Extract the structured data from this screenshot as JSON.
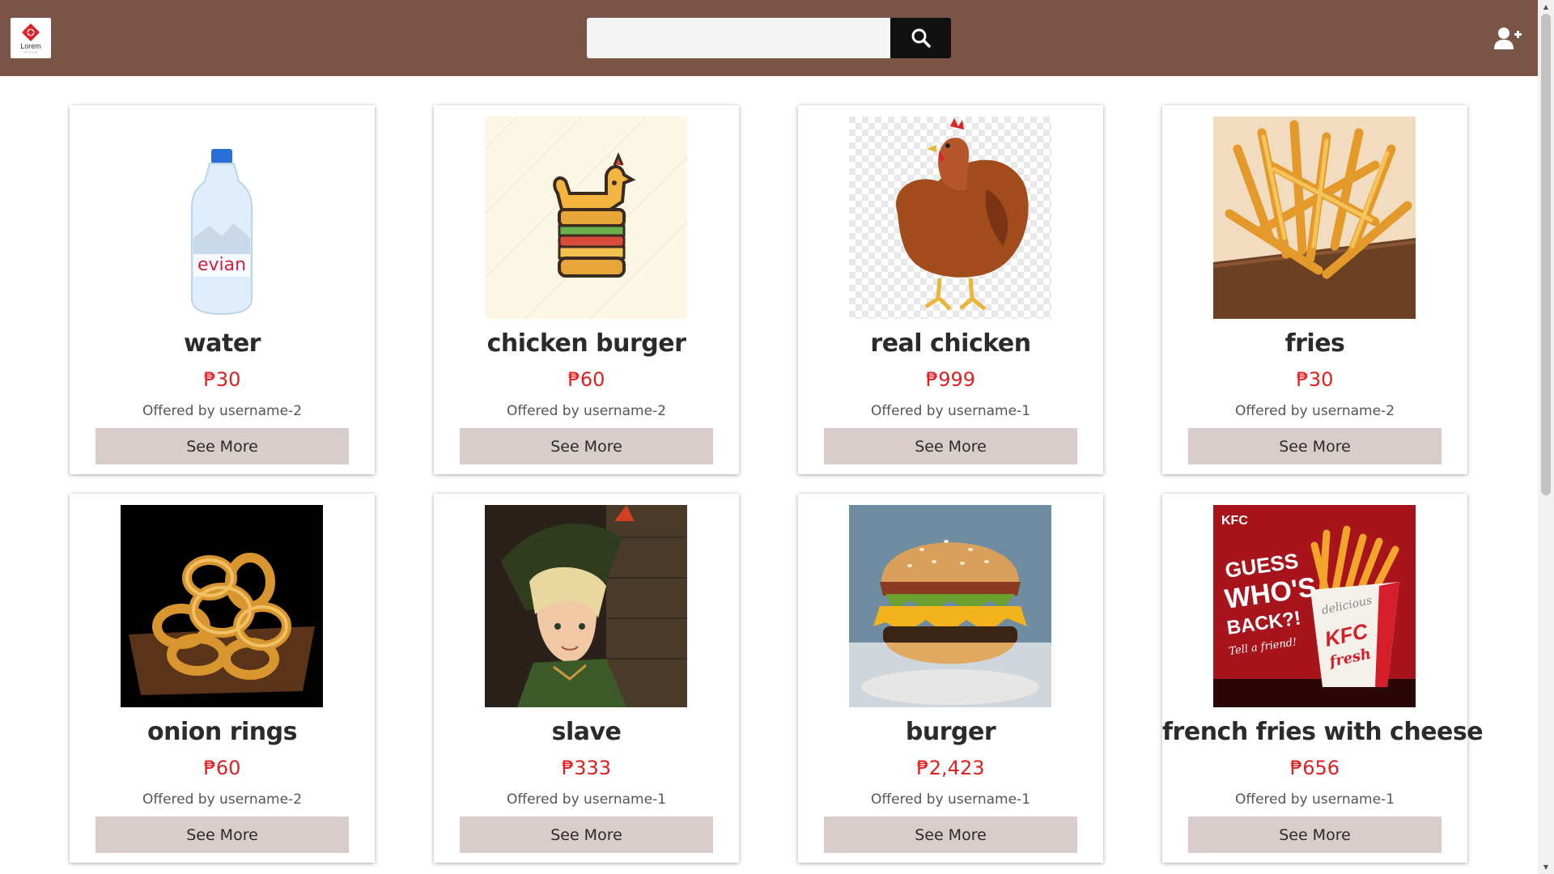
{
  "header": {
    "logo_text": "Lorem",
    "logo_sub": "IPSUM",
    "search_placeholder": "",
    "search_value": ""
  },
  "colors": {
    "header_bg": "#7a5446",
    "price": "#e02020",
    "button_bg": "#d8cdca"
  },
  "products": [
    {
      "name": "water",
      "price": "₱30",
      "offered_by": "Offered by username-2",
      "button": "See More",
      "image": "water-bottle"
    },
    {
      "name": "chicken burger",
      "price": "₱60",
      "offered_by": "Offered by username-2",
      "button": "See More",
      "image": "chicken-burger-logo"
    },
    {
      "name": "real chicken",
      "price": "₱999",
      "offered_by": "Offered by username-1",
      "button": "See More",
      "image": "hen"
    },
    {
      "name": "fries",
      "price": "₱30",
      "offered_by": "Offered by username-2",
      "button": "See More",
      "image": "fries"
    },
    {
      "name": "onion rings",
      "price": "₱60",
      "offered_by": "Offered by username-2",
      "button": "See More",
      "image": "onion-rings"
    },
    {
      "name": "slave",
      "price": "₱333",
      "offered_by": "Offered by username-1",
      "button": "See More",
      "image": "game-character"
    },
    {
      "name": "burger",
      "price": "₱2,423",
      "offered_by": "Offered by username-1",
      "button": "See More",
      "image": "burger"
    },
    {
      "name": "french fries with cheese",
      "price": "₱656",
      "offered_by": "Offered by username-1",
      "button": "See More",
      "image": "kfc-fries-ad"
    }
  ],
  "kfc_ad": {
    "brand": "KFC",
    "headline_1": "GUESS",
    "headline_2": "WHO'S",
    "headline_3": "BACK?!",
    "tagline": "Tell a friend!",
    "box_text_1": "delicious",
    "box_text_2": "KFC",
    "box_text_3": "fresh"
  },
  "water_label": "evian"
}
